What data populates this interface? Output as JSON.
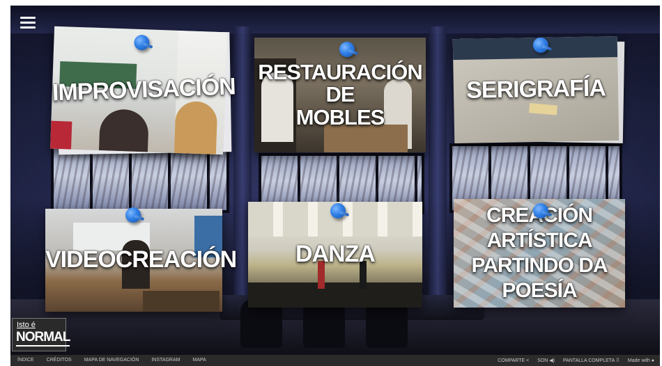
{
  "menu": {
    "icon": "hamburger-menu-icon"
  },
  "cards": [
    {
      "id": "improvisacion",
      "label": "IMPROVISACIÓN"
    },
    {
      "id": "restauracion",
      "label": "RESTAURACIÓN\nDE\nMOBLES"
    },
    {
      "id": "serigrafia",
      "label": "SERIGRAFÍA"
    },
    {
      "id": "videocreacion",
      "label": "VIDEOCREACIÓN"
    },
    {
      "id": "danza",
      "label": "DANZA"
    },
    {
      "id": "creacion",
      "label": "CREACIÓN ARTÍSTICA\nPARTINDO DA POESÍA"
    }
  ],
  "logo": {
    "line1": "Isto é",
    "line2": "NORMAL"
  },
  "footer": {
    "links": [
      "ÍNDICE",
      "CRÉDITOS",
      "MAPA DE NAVEGACIÓN",
      "INSTAGRAM",
      "MAPA"
    ],
    "share": "COMPARTE",
    "sound": "SON",
    "fullscreen": "PANTALLA COMPLETA",
    "made_with": "Made with"
  },
  "colors": {
    "pin": "#2f7fe6",
    "bar": "#2b2b2b"
  }
}
